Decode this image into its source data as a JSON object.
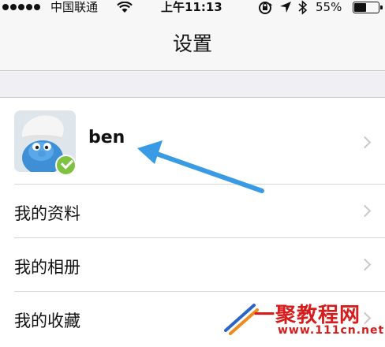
{
  "status_bar": {
    "carrier": "中国联通",
    "time": "上午11:13",
    "battery_text": "55%",
    "battery_level": 0.55,
    "icons": [
      "signal-dots",
      "wifi-icon",
      "rotation-lock-icon",
      "location-icon",
      "bluetooth-icon",
      "battery-icon"
    ]
  },
  "nav": {
    "title": "设置"
  },
  "profile": {
    "name": "ben",
    "verified": true
  },
  "menu": [
    {
      "label": "我的资料"
    },
    {
      "label": "我的相册"
    },
    {
      "label": "我的收藏"
    }
  ],
  "watermark": {
    "text": "一聚教程网",
    "url": "www.111cn.net"
  },
  "colors": {
    "arrow": "#3a9be5",
    "badge": "#7fc241",
    "watermark": "#d81b1b"
  }
}
